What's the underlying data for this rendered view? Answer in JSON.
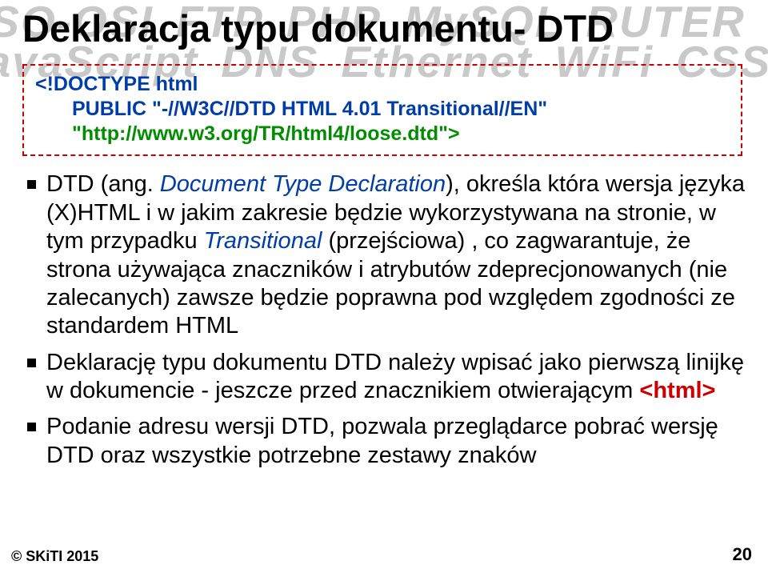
{
  "background": {
    "row1": [
      "ISO-OSI",
      "FTP",
      "PHP",
      "MySQL",
      "RUTER"
    ],
    "row2": [
      "JavaScript",
      "DNS",
      "Ethernet",
      "WiFi",
      "CSS"
    ]
  },
  "title": "Deklaracja typu dokumentu- DTD",
  "codebox": {
    "line1": "<!DOCTYPE html",
    "line2": "PUBLIC \"-//W3C//DTD HTML 4.01 Transitional//EN\"",
    "line3": "\"http://www.w3.org/TR/html4/loose.dtd\">"
  },
  "bullets": [
    {
      "pre": "DTD (ang. ",
      "ital": "Document Type Declaration",
      "post1": "), określa która wersja języka (X)HTML i w jakim zakresie będzie wykorzystywana na stronie, w tym przypadku ",
      "ital2": "Transitional",
      "post2": " (przejściowa) , co zagwarantuje, że strona używająca znaczników i atrybutów zdeprecjonowanych (nie zalecanych) zawsze będzie poprawna pod względem zgodności ze standardem HTML"
    },
    {
      "pre": "Deklarację typu dokumentu DTD należy wpisać jako pierwszą linijkę w dokumencie - jeszcze przed znacznikiem otwierającym ",
      "red": "<html>"
    },
    {
      "pre": "Podanie adresu wersji DTD, pozwala przeglądarce pobrać wersję DTD oraz wszystkie potrzebne zestawy znaków"
    }
  ],
  "footer": "© SKiTI 2015",
  "page": "20"
}
